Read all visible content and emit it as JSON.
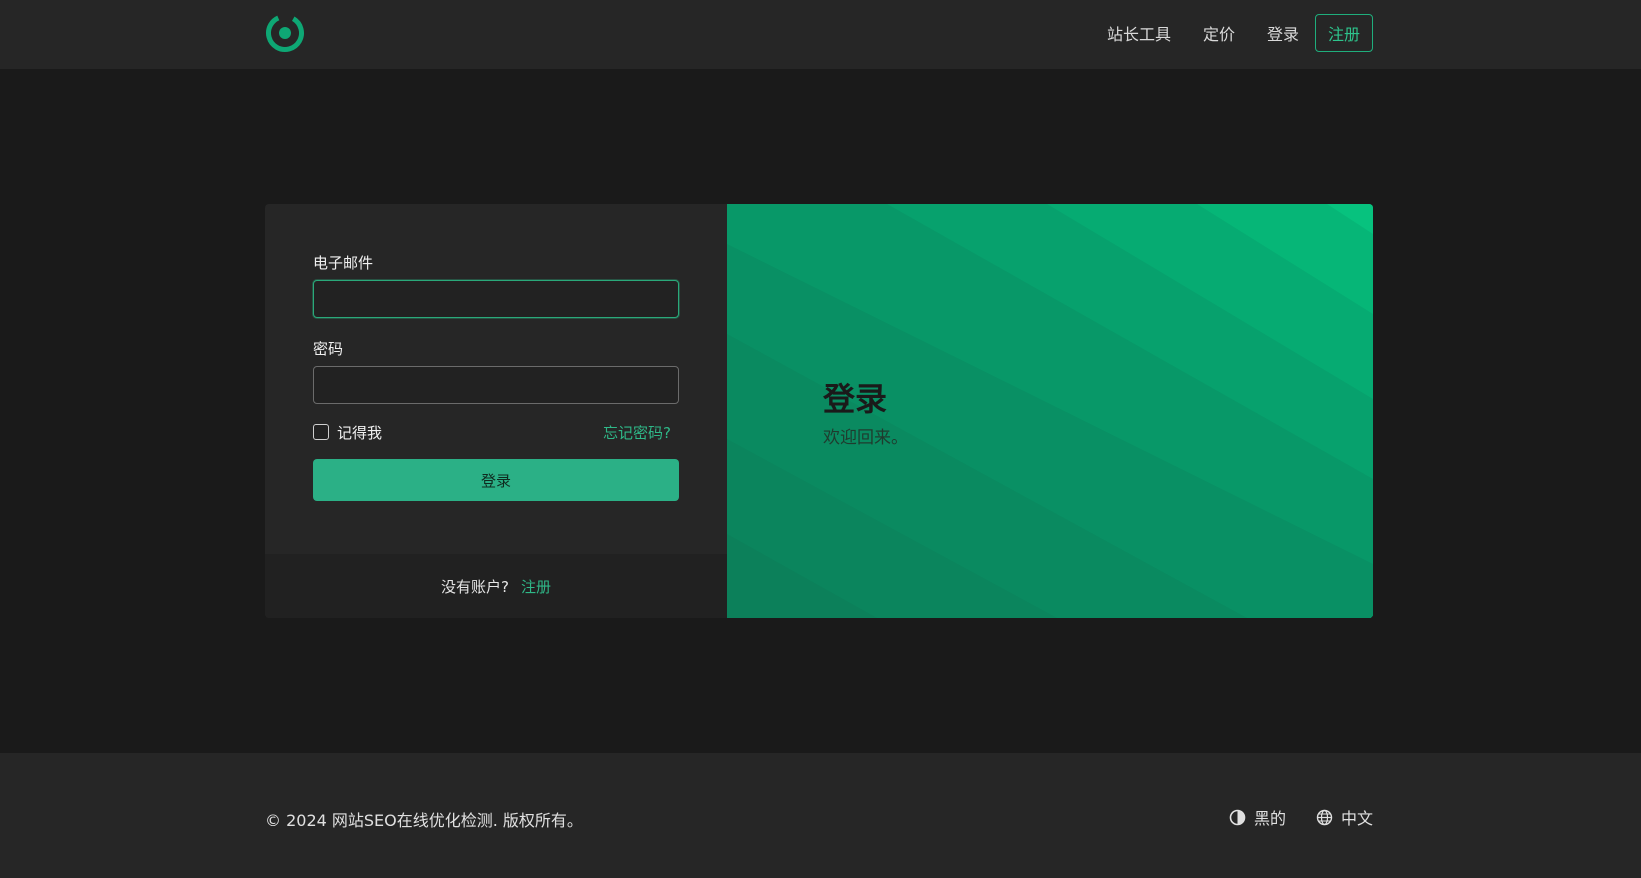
{
  "header": {
    "logo_icon": "circle-target-logo",
    "nav": [
      "站长工具",
      "定价",
      "登录"
    ],
    "signup_label": "注册",
    "accent_color": "#1fae7c"
  },
  "login_form": {
    "email_label": "电子邮件",
    "email_value": "",
    "password_label": "密码",
    "password_value": "",
    "remember_label": "记得我",
    "remember_checked": false,
    "forgot_label": "忘记密码?",
    "submit_label": "登录",
    "no_account_text": "没有账户?",
    "register_link": "注册"
  },
  "hero": {
    "title": "登录",
    "subtitle": "欢迎回来。",
    "background_color": "#07c27e"
  },
  "footer": {
    "copyright": "© 2024 网站SEO在线优化检测. 版权所有。",
    "theme_label": "黑的",
    "theme_icon": "contrast-icon",
    "language_label": "中文",
    "language_icon": "globe-icon"
  }
}
